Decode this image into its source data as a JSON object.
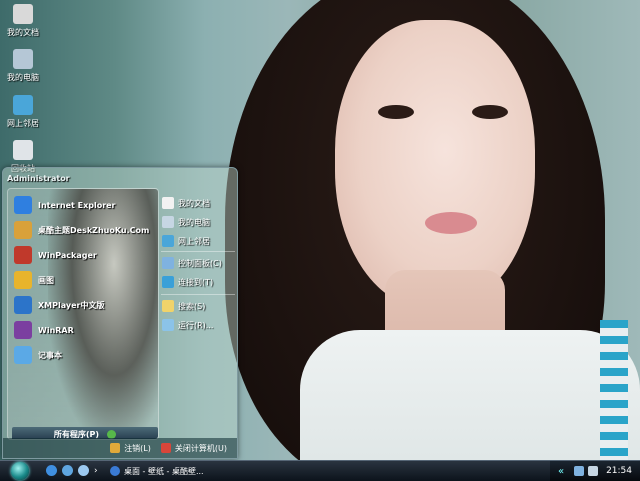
{
  "desktop": {
    "icons": [
      {
        "label": "我的文档",
        "icon": "folder-documents-icon",
        "color": "#d9d9d9"
      },
      {
        "label": "我的电脑",
        "icon": "computer-icon",
        "color": "#b5c7d6"
      },
      {
        "label": "网上邻居",
        "icon": "network-icon",
        "color": "#4aa6d9"
      },
      {
        "label": "回收站",
        "icon": "recycle-bin-icon",
        "color": "#e0e4e8"
      }
    ]
  },
  "start_menu": {
    "user": "Administrator",
    "programs": [
      {
        "label": "Internet Explorer",
        "icon": "internet-explorer-icon",
        "color": "#2f7fe0"
      },
      {
        "label": "桌酷主题DeskZhuoKu.Com",
        "icon": "zhuoku-theme-icon",
        "color": "#d9a13a"
      },
      {
        "label": "WinPackager",
        "icon": "winpackager-icon",
        "color": "#c0392b"
      },
      {
        "label": "画图",
        "icon": "paint-icon",
        "color": "#e8b42c"
      },
      {
        "label": "XMPlayer中文版",
        "icon": "xmplayer-icon",
        "color": "#2c74c9"
      },
      {
        "label": "WinRAR",
        "icon": "winrar-icon",
        "color": "#7b3fa0"
      },
      {
        "label": "记事本",
        "icon": "notepad-icon",
        "color": "#5ba9e6"
      }
    ],
    "all_programs": "所有程序(P)",
    "places": [
      {
        "label": "我的文档",
        "icon": "folder-documents-icon",
        "color": "#f2f2f2"
      },
      {
        "label": "我的电脑",
        "icon": "computer-icon",
        "color": "#c6d6e3"
      },
      {
        "label": "网上邻居",
        "icon": "network-icon",
        "color": "#4aa6d9"
      },
      {
        "label": "控制面板(C)",
        "icon": "control-panel-icon",
        "color": "#7fb2e0"
      },
      {
        "label": "连接到(T)",
        "icon": "connect-icon",
        "color": "#3aa0d8"
      },
      {
        "label": "搜索(S)",
        "icon": "search-icon",
        "color": "#f0d36a"
      },
      {
        "label": "运行(R)...",
        "icon": "run-icon",
        "color": "#8bc3e8"
      }
    ],
    "logoff": "注销(L)",
    "shutdown": "关闭计算机(U)"
  },
  "taskbar": {
    "task_button": "桌面 - 壁纸 - 桌酷壁...",
    "clock": "21:54",
    "chevron": "«"
  }
}
